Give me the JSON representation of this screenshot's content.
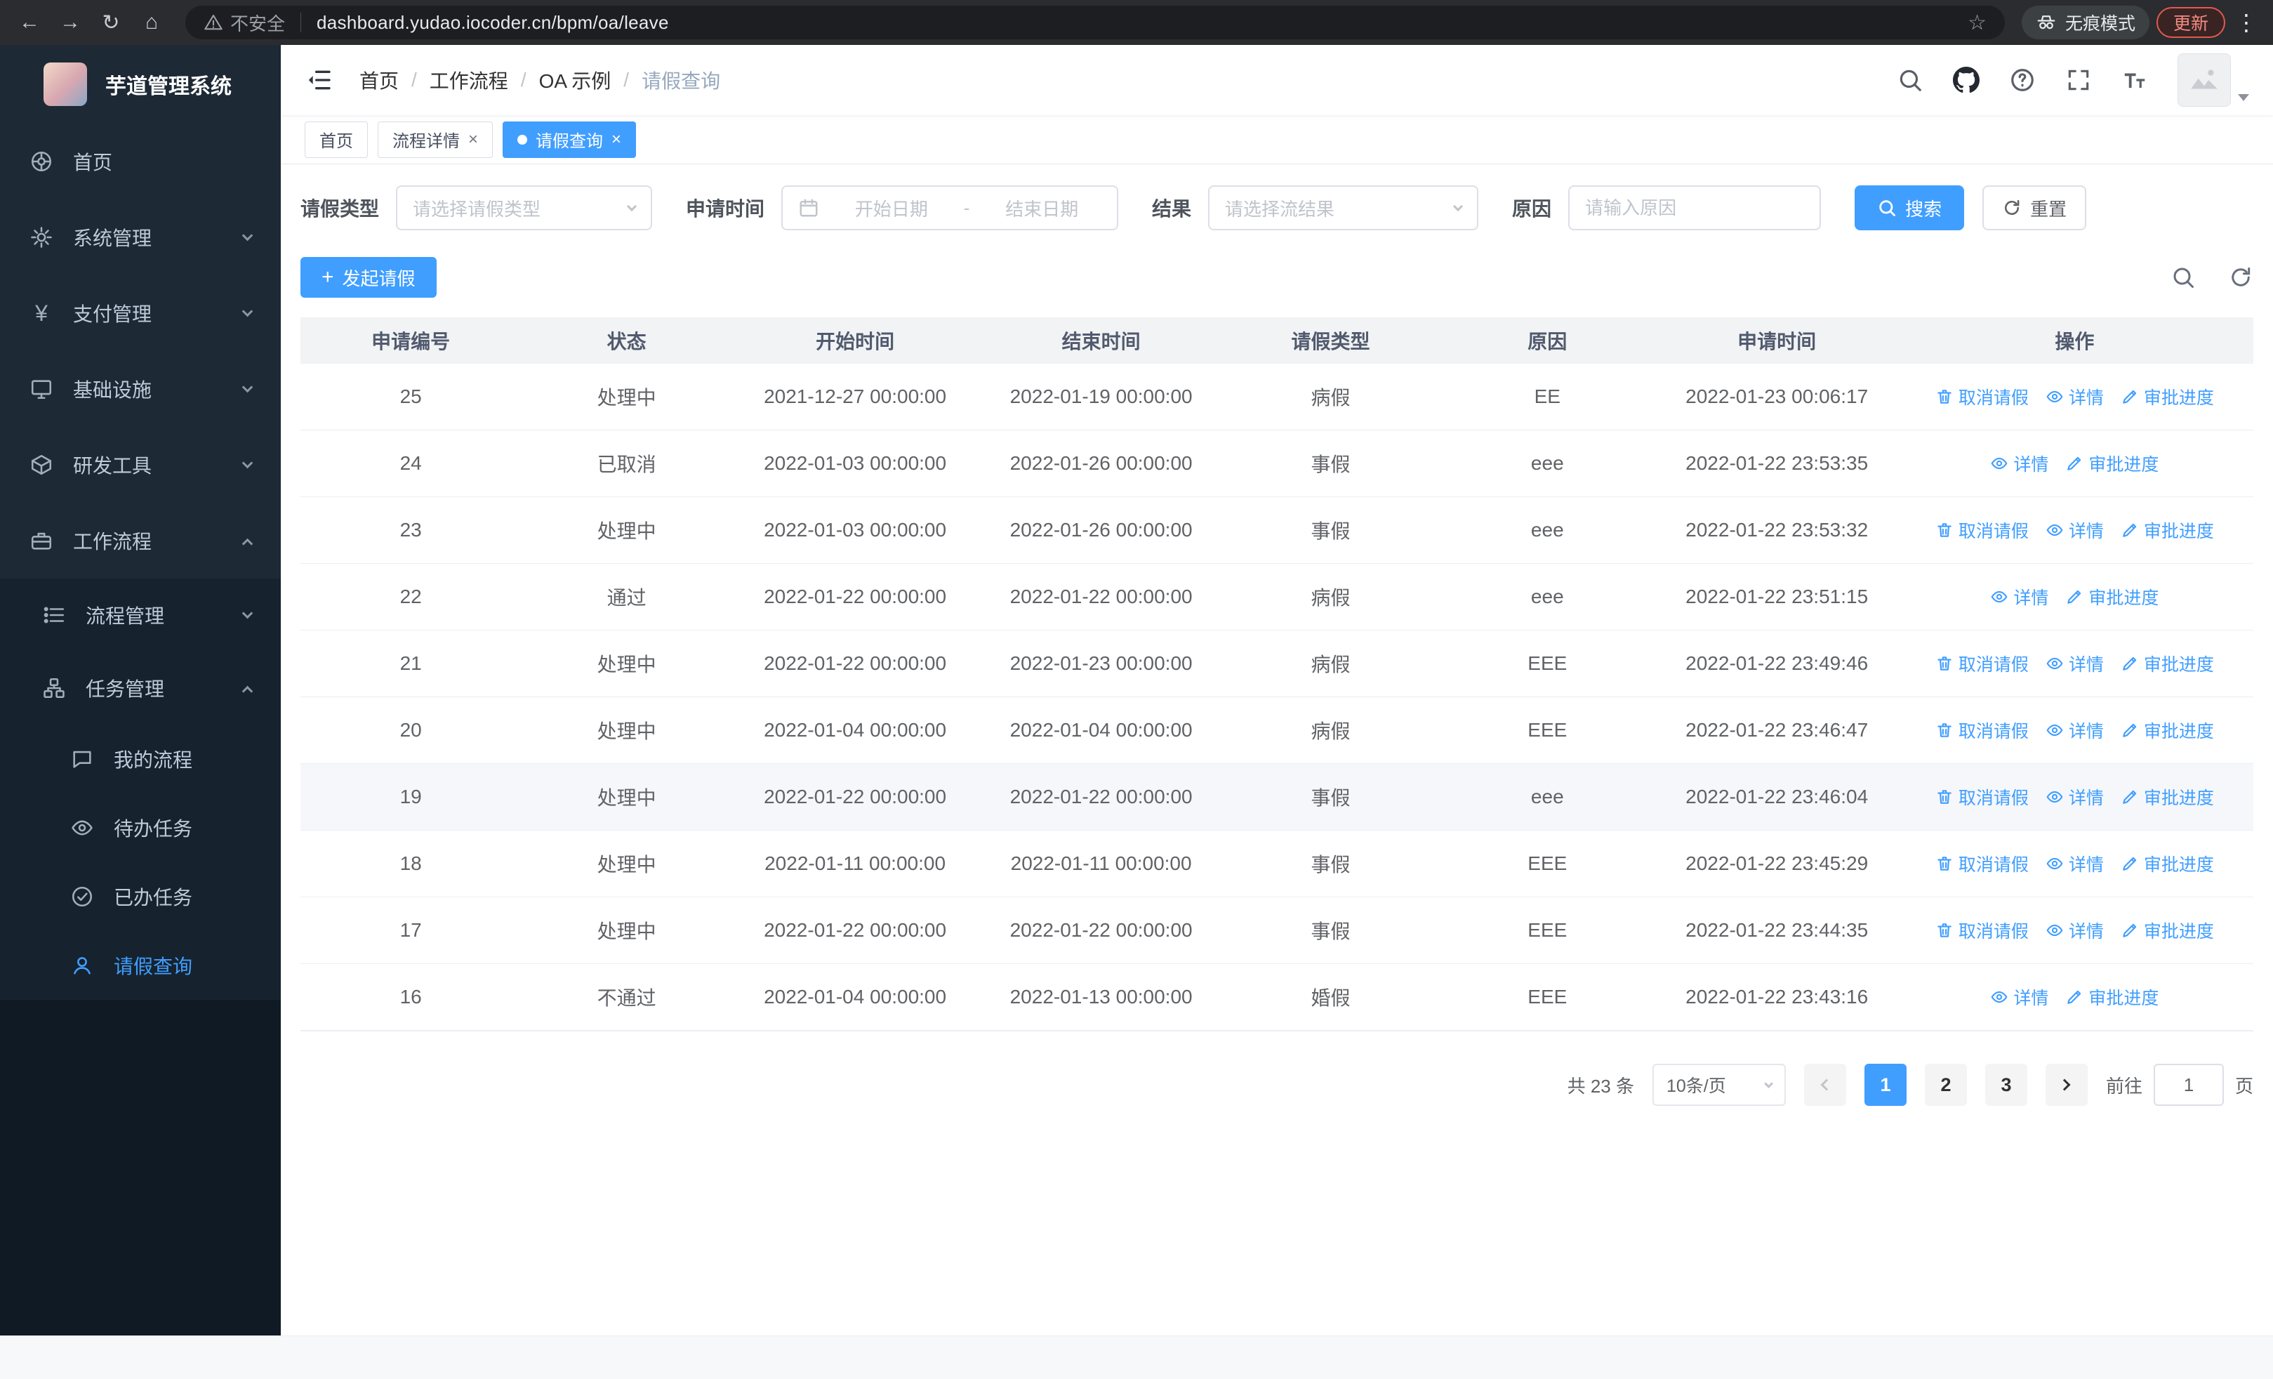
{
  "browser": {
    "security_label": "不安全",
    "url": "dashboard.yudao.iocoder.cn/bpm/oa/leave",
    "incognito_label": "无痕模式",
    "update_label": "更新"
  },
  "sidebar": {
    "title": "芋道管理系统",
    "menu": [
      {
        "label": "首页"
      },
      {
        "label": "系统管理"
      },
      {
        "label": "支付管理"
      },
      {
        "label": "基础设施"
      },
      {
        "label": "研发工具"
      },
      {
        "label": "工作流程"
      }
    ],
    "submenu": [
      {
        "label": "流程管理"
      },
      {
        "label": "任务管理"
      }
    ],
    "leaves": [
      {
        "label": "我的流程"
      },
      {
        "label": "待办任务"
      },
      {
        "label": "已办任务"
      },
      {
        "label": "请假查询"
      }
    ]
  },
  "header": {
    "breadcrumb": [
      "首页",
      "工作流程",
      "OA 示例",
      "请假查询"
    ]
  },
  "tabs": [
    {
      "label": "首页"
    },
    {
      "label": "流程详情"
    },
    {
      "label": "请假查询"
    }
  ],
  "filters": {
    "type_label": "请假类型",
    "type_placeholder": "请选择请假类型",
    "time_label": "申请时间",
    "start_placeholder": "开始日期",
    "range_separator": "-",
    "end_placeholder": "结束日期",
    "result_label": "结果",
    "result_placeholder": "请选择流结果",
    "reason_label": "原因",
    "reason_placeholder": "请输入原因",
    "search_label": "搜索",
    "reset_label": "重置"
  },
  "toolbar": {
    "create_label": "发起请假"
  },
  "table": {
    "columns": [
      "申请编号",
      "状态",
      "开始时间",
      "结束时间",
      "请假类型",
      "原因",
      "申请时间",
      "操作"
    ],
    "op_defs": {
      "cancel": {
        "label": "取消请假",
        "icon": "trash-icon"
      },
      "detail": {
        "label": "详情",
        "icon": "eye-icon"
      },
      "progress": {
        "label": "审批进度",
        "icon": "edit-icon"
      }
    },
    "rows": [
      {
        "id": "25",
        "status": "处理中",
        "start": "2021-12-27 00:00:00",
        "end": "2022-01-19 00:00:00",
        "type": "病假",
        "reason": "EE",
        "apply_time": "2022-01-23 00:06:17",
        "ops": [
          "cancel",
          "detail",
          "progress"
        ]
      },
      {
        "id": "24",
        "status": "已取消",
        "start": "2022-01-03 00:00:00",
        "end": "2022-01-26 00:00:00",
        "type": "事假",
        "reason": "eee",
        "apply_time": "2022-01-22 23:53:35",
        "ops": [
          "detail",
          "progress"
        ]
      },
      {
        "id": "23",
        "status": "处理中",
        "start": "2022-01-03 00:00:00",
        "end": "2022-01-26 00:00:00",
        "type": "事假",
        "reason": "eee",
        "apply_time": "2022-01-22 23:53:32",
        "ops": [
          "cancel",
          "detail",
          "progress"
        ]
      },
      {
        "id": "22",
        "status": "通过",
        "start": "2022-01-22 00:00:00",
        "end": "2022-01-22 00:00:00",
        "type": "病假",
        "reason": "eee",
        "apply_time": "2022-01-22 23:51:15",
        "ops": [
          "detail",
          "progress"
        ]
      },
      {
        "id": "21",
        "status": "处理中",
        "start": "2022-01-22 00:00:00",
        "end": "2022-01-23 00:00:00",
        "type": "病假",
        "reason": "EEE",
        "apply_time": "2022-01-22 23:49:46",
        "ops": [
          "cancel",
          "detail",
          "progress"
        ]
      },
      {
        "id": "20",
        "status": "处理中",
        "start": "2022-01-04 00:00:00",
        "end": "2022-01-04 00:00:00",
        "type": "病假",
        "reason": "EEE",
        "apply_time": "2022-01-22 23:46:47",
        "ops": [
          "cancel",
          "detail",
          "progress"
        ]
      },
      {
        "id": "19",
        "status": "处理中",
        "start": "2022-01-22 00:00:00",
        "end": "2022-01-22 00:00:00",
        "type": "事假",
        "reason": "eee",
        "apply_time": "2022-01-22 23:46:04",
        "ops": [
          "cancel",
          "detail",
          "progress"
        ],
        "highlight": true
      },
      {
        "id": "18",
        "status": "处理中",
        "start": "2022-01-11 00:00:00",
        "end": "2022-01-11 00:00:00",
        "type": "事假",
        "reason": "EEE",
        "apply_time": "2022-01-22 23:45:29",
        "ops": [
          "cancel",
          "detail",
          "progress"
        ]
      },
      {
        "id": "17",
        "status": "处理中",
        "start": "2022-01-22 00:00:00",
        "end": "2022-01-22 00:00:00",
        "type": "事假",
        "reason": "EEE",
        "apply_time": "2022-01-22 23:44:35",
        "ops": [
          "cancel",
          "detail",
          "progress"
        ]
      },
      {
        "id": "16",
        "status": "不通过",
        "start": "2022-01-04 00:00:00",
        "end": "2022-01-13 00:00:00",
        "type": "婚假",
        "reason": "EEE",
        "apply_time": "2022-01-22 23:43:16",
        "ops": [
          "detail",
          "progress"
        ]
      }
    ]
  },
  "pagination": {
    "total_label": "共 23 条",
    "page_size": "10条/页",
    "pages": [
      "1",
      "2",
      "3"
    ],
    "active_page": "1",
    "goto_label": "前往",
    "goto_value": "1",
    "goto_suffix": "页"
  },
  "colors": {
    "accent": "#409eff"
  }
}
